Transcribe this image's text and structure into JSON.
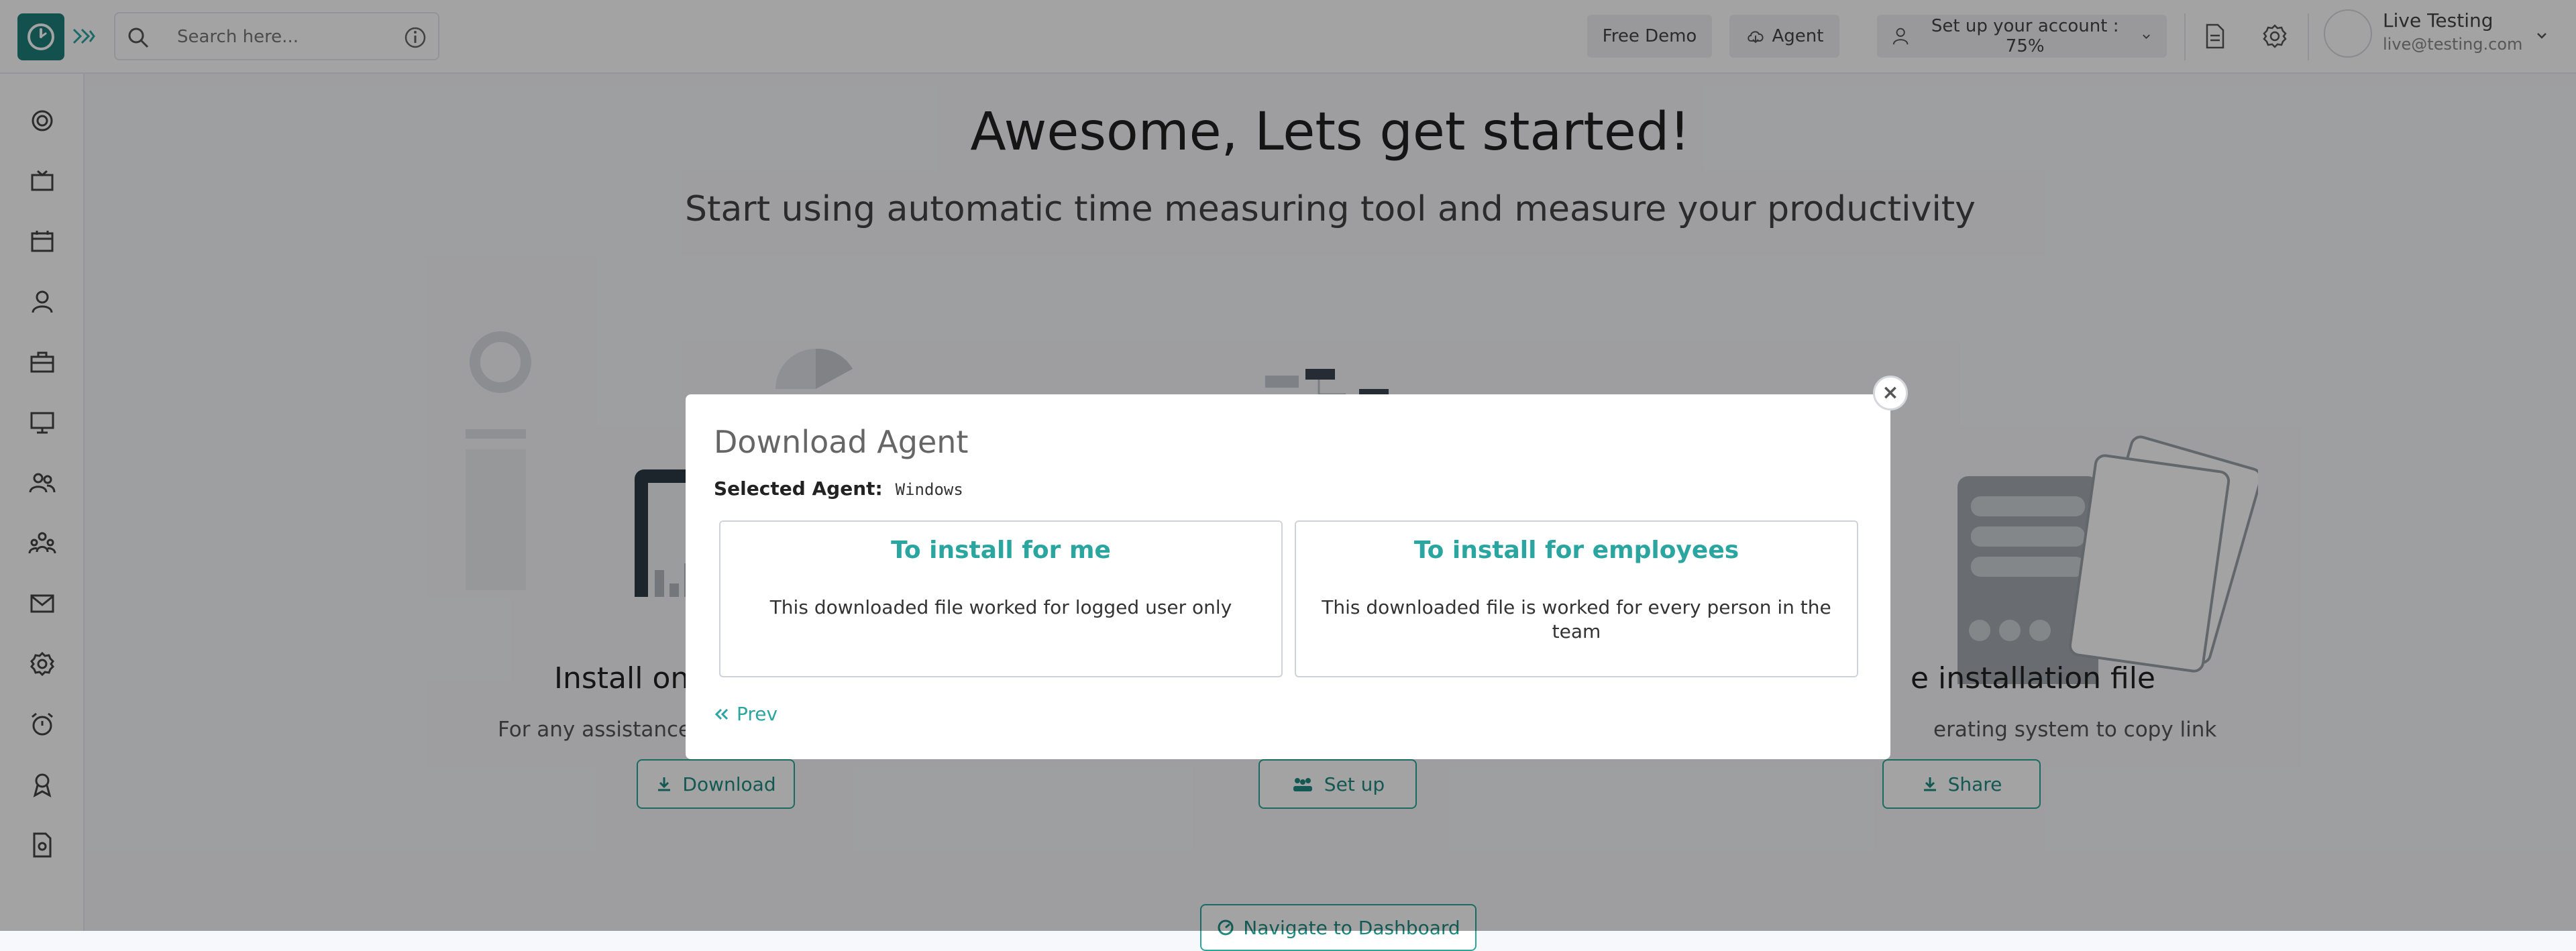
{
  "search": {
    "placeholder": "Search here..."
  },
  "header": {
    "free_demo_label": "Free Demo",
    "agent_label": "Agent",
    "setup_label": "Set up your account : 75%",
    "setup_progress_percent": 75
  },
  "user": {
    "name": "Live Testing",
    "email": "live@testing.com"
  },
  "sidebar": {
    "icons": [
      "dashboard-icon",
      "tv-icon",
      "calendar-icon",
      "user-icon",
      "briefcase-icon",
      "monitor-icon",
      "users-icon",
      "team-icon",
      "mail-icon",
      "settings-icon",
      "alarm-icon",
      "award-icon",
      "report-icon"
    ]
  },
  "main": {
    "headline": "Awesome, Lets get started!",
    "subline": "Start using automatic time measuring tool and measure your productivity",
    "steps": [
      {
        "title": "Install on",
        "desc": "For any assistance,",
        "button": "Download"
      },
      {
        "button": "Set up"
      },
      {
        "title": "e installation file",
        "desc": "erating system to copy link",
        "button": "Share"
      }
    ],
    "navigate_label": "Navigate to Dashboard"
  },
  "modal": {
    "title": "Download Agent",
    "selected_label": "Selected Agent:",
    "selected_value": "Windows",
    "options": [
      {
        "title": "To install for me",
        "desc": "This downloaded file worked for logged user only"
      },
      {
        "title": "To install for employees",
        "desc": "This downloaded file is worked for every person in the team"
      }
    ],
    "prev_label": "Prev",
    "close_symbol": "×"
  },
  "colors": {
    "accent": "#2aa5a0",
    "brand": "#1f7f7b",
    "overlay": "rgba(0,0,0,0.36)"
  }
}
